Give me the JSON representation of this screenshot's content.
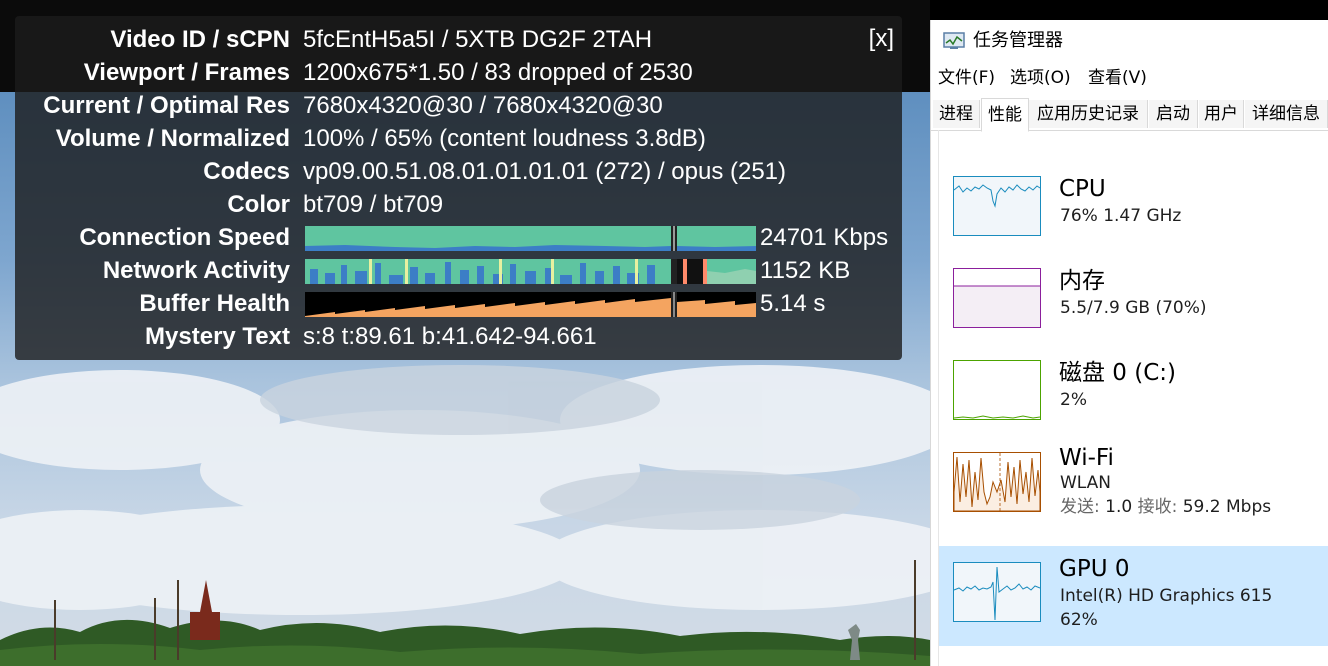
{
  "stats": {
    "close_label": "[x]",
    "rows": [
      {
        "label": "Video ID / sCPN",
        "value": "5fcEntH5a5I / 5XTB DG2F 2TAH"
      },
      {
        "label": "Viewport / Frames",
        "value": "1200x675*1.50 / 83 dropped of 2530"
      },
      {
        "label": "Current / Optimal Res",
        "value": "7680x4320@30 / 7680x4320@30"
      },
      {
        "label": "Volume / Normalized",
        "value": "100% / 65% (content loudness 3.8dB)"
      },
      {
        "label": "Codecs",
        "value": "vp09.00.51.08.01.01.01.01 (272) / opus (251)"
      },
      {
        "label": "Color",
        "value": "bt709 / bt709"
      },
      {
        "label": "Connection Speed",
        "value": "24701 Kbps"
      },
      {
        "label": "Network Activity",
        "value": "1152 KB"
      },
      {
        "label": "Buffer Health",
        "value": "5.14 s"
      },
      {
        "label": "Mystery Text",
        "value": "s:8 t:89.61 b:41.642-94.661"
      }
    ],
    "colors": {
      "connection": "#5fc5a0",
      "connection_line": "#2e6fb8",
      "network": "#4a8fd6",
      "network_bg": "#5fc5a0",
      "buffer": "#f4a460"
    }
  },
  "taskmgr": {
    "title": "任务管理器",
    "menu": [
      "文件(F)",
      "选项(O)",
      "查看(V)"
    ],
    "tabs": [
      "进程",
      "性能",
      "应用历史记录",
      "启动",
      "用户",
      "详细信息"
    ],
    "active_tab": "性能",
    "items": [
      {
        "name": "CPU",
        "line1": "76%  1.47 GHz",
        "line2": "",
        "color": "#1a8cbe",
        "selected": false
      },
      {
        "name": "内存",
        "line1": "5.5/7.9 GB (70%)",
        "line2": "",
        "color": "#8b1f9c",
        "selected": false
      },
      {
        "name": "磁盘 0 (C:)",
        "line1": "2%",
        "line2": "",
        "color": "#4ca300",
        "selected": false
      },
      {
        "name": "Wi-Fi",
        "line1": "WLAN",
        "send_label": "发送:",
        "send_value": "1.0",
        "recv_label": "接收:",
        "recv_value": "59.2 Mbps",
        "color": "#a74f01",
        "selected": false
      },
      {
        "name": "GPU 0",
        "line1": "Intel(R) HD Graphics 615",
        "line2": "62%",
        "color": "#1a8cbe",
        "selected": true
      }
    ]
  }
}
